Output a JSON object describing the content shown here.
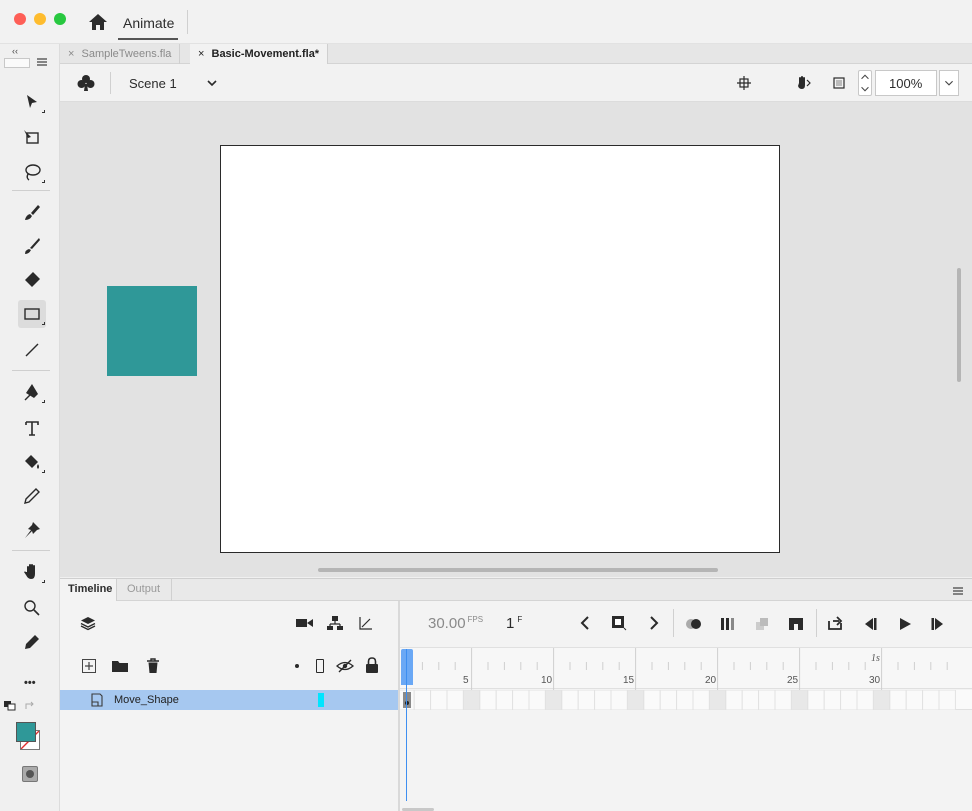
{
  "window": {
    "app_name": "Animate"
  },
  "doc_tabs": [
    {
      "label": "SampleTweens.fla",
      "close": "×"
    },
    {
      "label": "Basic-Movement.fla*",
      "close": "×"
    }
  ],
  "edit_bar": {
    "scene_label": "Scene 1",
    "zoom": "100%"
  },
  "stage": {
    "shape_color": "#2f9898",
    "stage_color": "#ffffff"
  },
  "timeline": {
    "tab_timeline": "Timeline",
    "tab_output": "Output",
    "fps": "30.00",
    "fps_unit": "FPS",
    "frame": "1",
    "frame_unit": "F",
    "seconds_marker": "1s",
    "ruler_numbers": [
      "5",
      "10",
      "15",
      "20",
      "25",
      "30"
    ],
    "layers": [
      {
        "name": "Move_Shape",
        "color": "#00e5ff"
      }
    ]
  },
  "toolbar": {
    "collapse": "‹‹",
    "fill_color": "#2f9898",
    "more_tools": "•••"
  },
  "colors": {
    "accent": "#3d8ef0",
    "selection": "#a6c8f0"
  }
}
